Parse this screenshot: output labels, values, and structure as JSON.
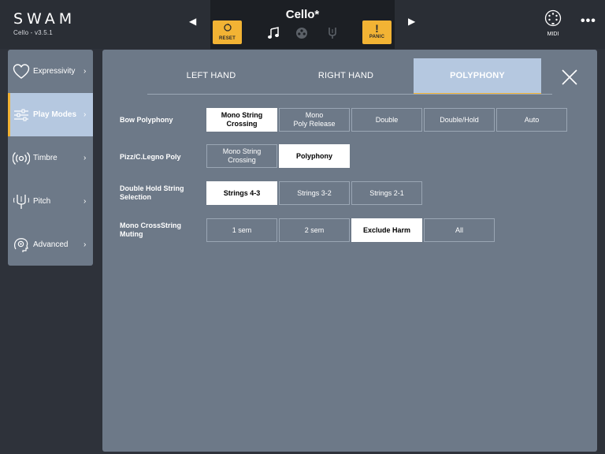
{
  "header": {
    "brand": "SWAM",
    "version": "Cello - v3.5.1",
    "instrument": "Cello*",
    "reset_label": "RESET",
    "panic_label": "PANIC",
    "midi_label": "MIDI"
  },
  "sidebar": {
    "items": [
      {
        "label": "Expressivity",
        "icon": "heart-icon"
      },
      {
        "label": "Play Modes",
        "icon": "sliders-icon",
        "active": true
      },
      {
        "label": "Timbre",
        "icon": "radio-waves-icon"
      },
      {
        "label": "Pitch",
        "icon": "tuning-fork-icon"
      },
      {
        "label": "Advanced",
        "icon": "gear-head-icon"
      }
    ]
  },
  "tabs": {
    "left_hand": "LEFT HAND",
    "right_hand": "RIGHT HAND",
    "polyphony": "POLYPHONY",
    "active": "POLYPHONY"
  },
  "rows": {
    "bow_polyphony": {
      "label": "Bow Polyphony",
      "options": [
        "Mono String\nCrossing",
        "Mono\nPoly Release",
        "Double",
        "Double/Hold",
        "Auto"
      ],
      "selected": "Mono String\nCrossing"
    },
    "pizz_poly": {
      "label": "Pizz/C.Legno Poly",
      "options": [
        "Mono String\nCrossing",
        "Polyphony"
      ],
      "selected": "Polyphony"
    },
    "double_hold": {
      "label_line1": "Double Hold String",
      "label_line2": "Selection",
      "options": [
        "Strings 4-3",
        "Strings 3-2",
        "Strings 2-1"
      ],
      "selected": "Strings 4-3"
    },
    "mono_crossstring": {
      "label_line1": "Mono CrossString",
      "label_line2": "Muting",
      "options": [
        "1 sem",
        "2 sem",
        "Exclude Harm",
        "All"
      ],
      "selected": "Exclude Harm"
    }
  },
  "colors": {
    "accent_yellow": "#f2b334",
    "panel": "#6d7988",
    "active_tab": "#b5c8e0",
    "background": "#2e323a"
  }
}
